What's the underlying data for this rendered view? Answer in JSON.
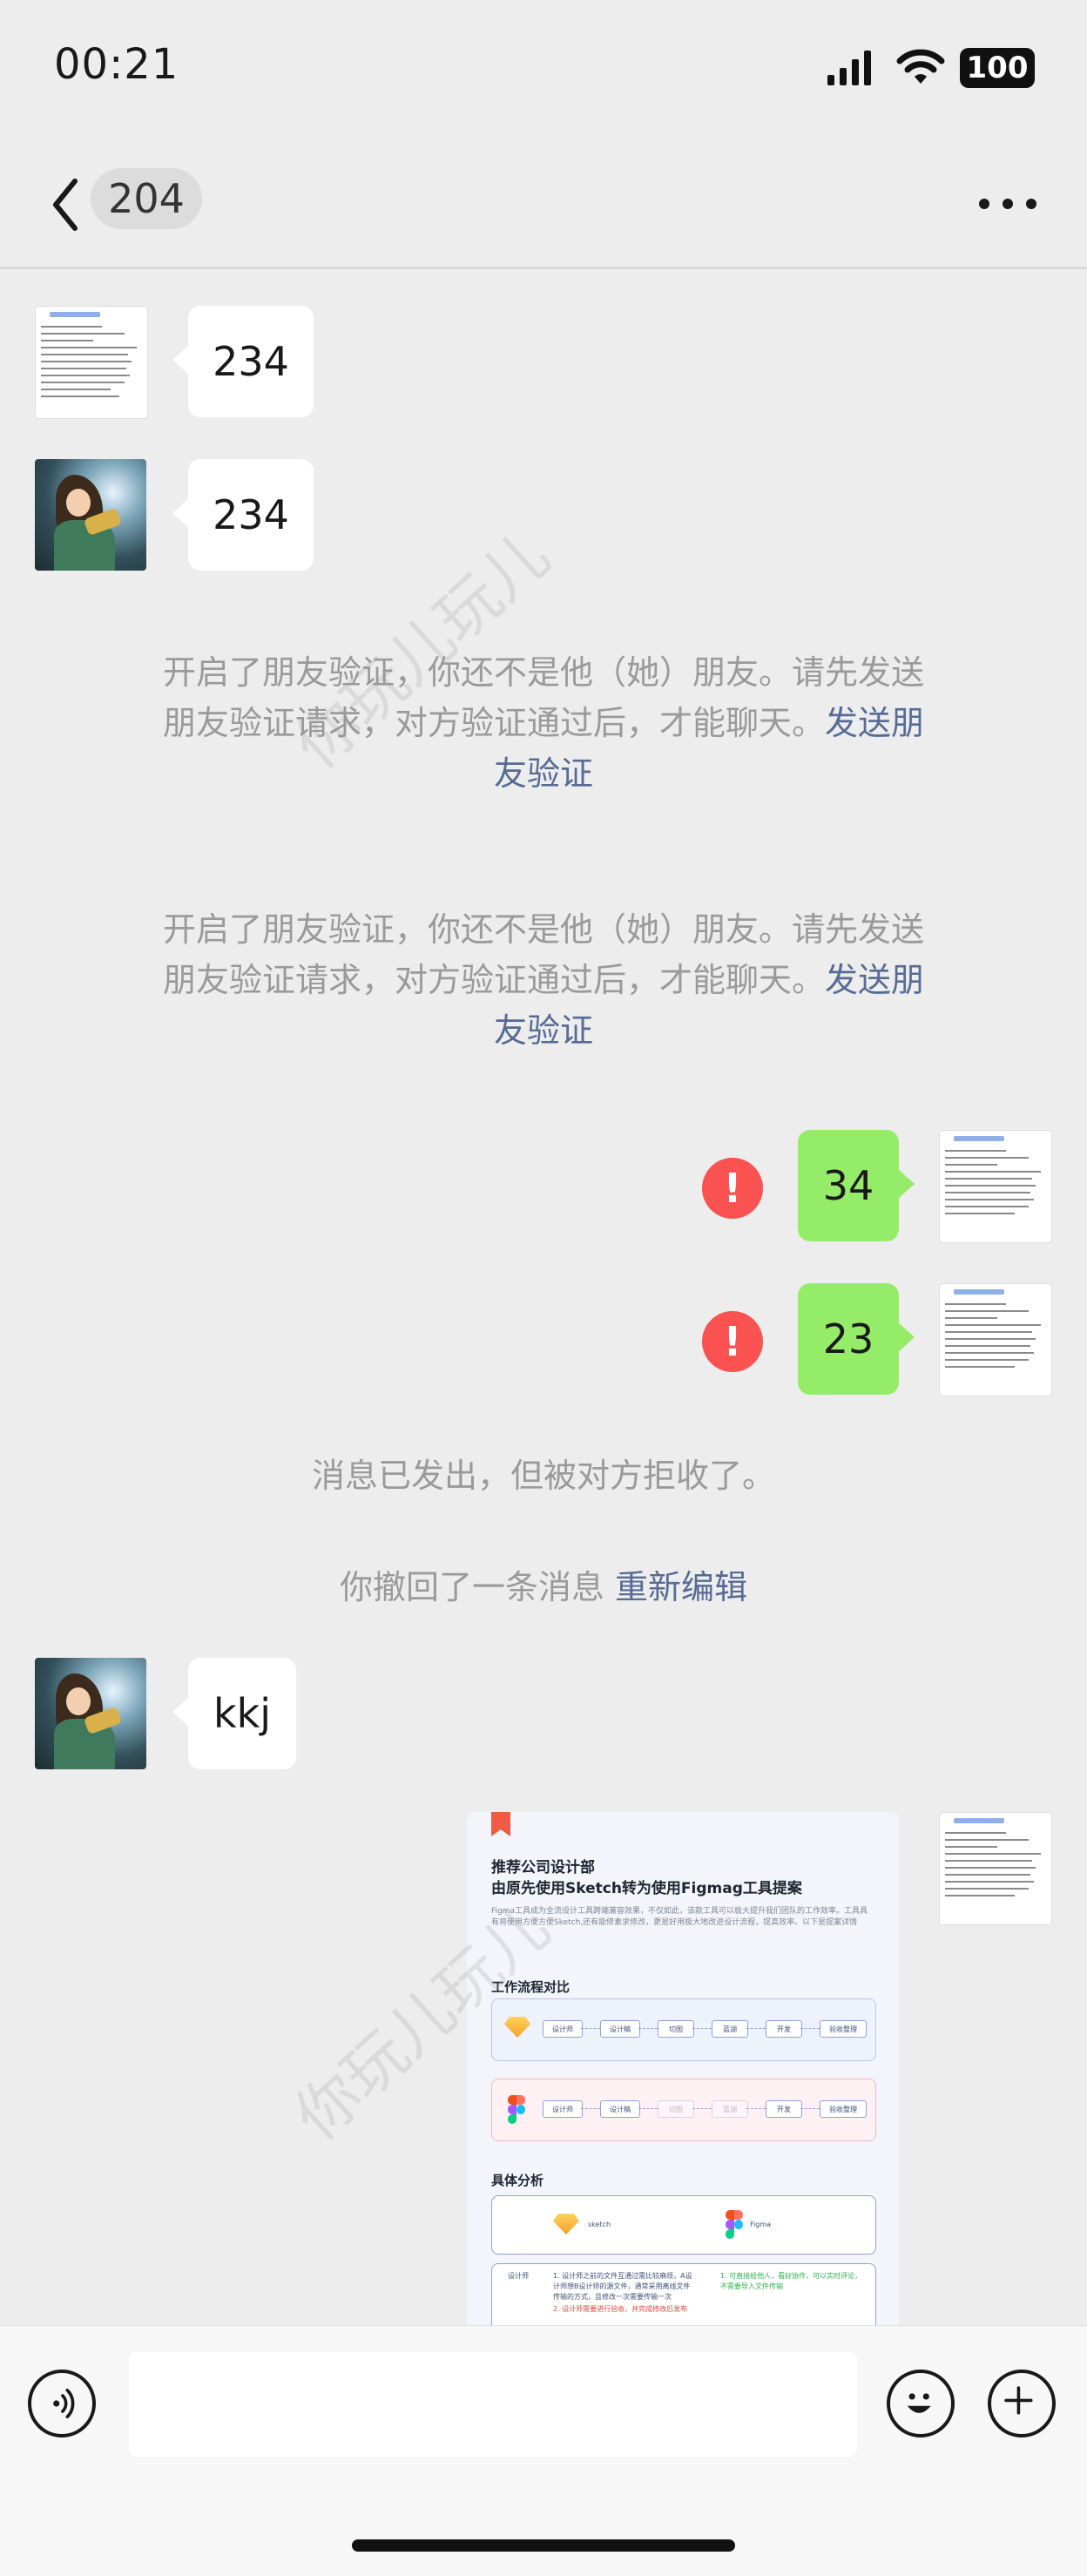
{
  "status_bar": {
    "time": "00:21",
    "battery": "100"
  },
  "nav": {
    "title_count": "204"
  },
  "messages": {
    "m1": "234",
    "m2": "234",
    "notice1": {
      "text": "开启了朋友验证，你还不是他（她）朋友。请先发送朋友验证请求，对方验证通过后，才能聊天。",
      "link": "发送朋友验证"
    },
    "notice2": {
      "text": "开启了朋友验证，你还不是他（她）朋友。请先发送朋友验证请求，对方验证通过后，才能聊天。",
      "link": "发送朋友验证"
    },
    "m3": "34",
    "m4": "23",
    "fail_mark": "!",
    "rejected": "消息已发出，但被对方拒收了。",
    "recall": {
      "text": "你撤回了一条消息 ",
      "link": "重新编辑"
    },
    "m5": "kkj"
  },
  "doc_card": {
    "title_line1": "推荐公司设计部",
    "title_line2": "由原先使用Sketch转为使用Figmag工具提案",
    "desc": "Figma工具成为全流设计工具跨端兼容效果，不仅如此，该款工具可以极大提升我们团队的工作效率。工具具有将使用方便方便Sketch,还有能修素求修改，更是好用极大地改进设计流程，提高效率。以下是提案详情",
    "section1": "工作流程对比",
    "section2": "具体分析",
    "steps_row1": [
      "设计师",
      "设计稿",
      "切图",
      "蓝湖",
      "开发",
      "验收整理"
    ],
    "steps_row2": [
      "设计师",
      "设计稿",
      "切图",
      "蓝湖",
      "开发",
      "验收整理"
    ],
    "tool1": "sketch",
    "tool2": "Figma",
    "row_label": "设计师",
    "sketch_note": "1. 设计师之前的文件互通过需比较麻烦，A设计师想B设计师的源文件，通常采用离线文件传输的方式，且修改一次需要传输一次",
    "sketch_note2": "2. 设计师需要进行验收，并完成修改后发布",
    "figma_note": "1. 可直接给他人，看好协作，可以实时评论，不需要导入文件传输"
  },
  "watermark": "你玩儿玩儿",
  "colors": {
    "outgoing_bubble": "#95EC69",
    "link": "#576B95",
    "error": "#FA5151"
  },
  "icons": [
    "signal-icon",
    "wifi-icon",
    "battery-icon",
    "back-icon",
    "more-icon",
    "voice-icon",
    "emoji-icon",
    "plus-icon"
  ]
}
